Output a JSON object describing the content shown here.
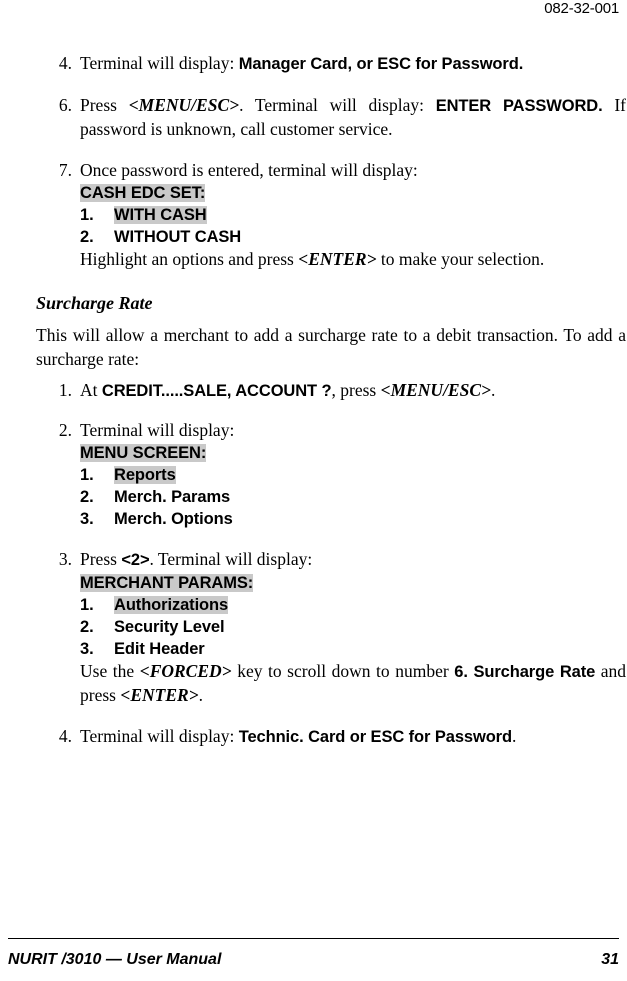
{
  "header": {
    "doc_number": "082-32-001"
  },
  "footer": {
    "manual_title": "NURIT /3010 — User Manual",
    "page_number": "31"
  },
  "colors": {
    "highlight": "#c9c9c9",
    "text": "#000000",
    "page_background": "#ffffff"
  },
  "steps_top": [
    {
      "number": "4.",
      "lead": "Terminal will display:",
      "display_text": "Manager Card, or ESC for Password."
    },
    {
      "number": "6.",
      "press_label": "Press",
      "key": "<MENU/ESC>",
      "mid": ". Terminal will display:",
      "display_text": "ENTER PASSWORD.",
      "after": "If password is unknown, call customer service."
    },
    {
      "number": "7.",
      "lead": "Once password is entered, terminal will display:",
      "screen_title": "CASH EDC SET:",
      "screen_items": [
        {
          "index": "1.",
          "label": "WITH CASH",
          "highlighted": true
        },
        {
          "index": "2.",
          "label": "WITHOUT CASH",
          "highlighted": false
        }
      ],
      "tail_before": "Highlight an options and press",
      "tail_key": "<ENTER>",
      "tail_after": "to make your selection."
    }
  ],
  "section": {
    "heading": "Surcharge Rate",
    "intro": "This will allow a merchant to add a surcharge rate to a debit transaction.  To add a surcharge rate:",
    "steps": [
      {
        "number": "1.",
        "at_label": "At",
        "display_text": "CREDIT.....SALE, ACCOUNT ?",
        "press_label": ", press",
        "key": "<MENU/ESC>",
        "period": "."
      },
      {
        "number": "2.",
        "lead": "Terminal will display:",
        "screen_title": "MENU SCREEN:",
        "screen_items": [
          {
            "index": "1.",
            "label": "Reports",
            "highlighted": true
          },
          {
            "index": "2.",
            "label": "Merch. Params",
            "highlighted": false
          },
          {
            "index": "3.",
            "label": "Merch. Options",
            "highlighted": false
          }
        ]
      },
      {
        "number": "3.",
        "press_label": "Press",
        "key": "<2>",
        "lead": ". Terminal will display:",
        "screen_title": "MERCHANT PARAMS:",
        "screen_items": [
          {
            "index": "1.",
            "label": "Authorizations",
            "highlighted": true
          },
          {
            "index": "2.",
            "label": "Security Level",
            "highlighted": false
          },
          {
            "index": "3.",
            "label": "Edit Header",
            "highlighted": false
          }
        ],
        "tail_before": "Use the",
        "tail_key": "<FORCED>",
        "tail_mid": "key to scroll down to number",
        "tail_bold": "6. Surcharge Rate",
        "tail_after": "and press",
        "tail_key2": "<ENTER>",
        "tail_period": "."
      },
      {
        "number": "4.",
        "lead": "Terminal will display:",
        "display_text": "Technic. Card or ESC for Password",
        "period": "."
      }
    ]
  }
}
